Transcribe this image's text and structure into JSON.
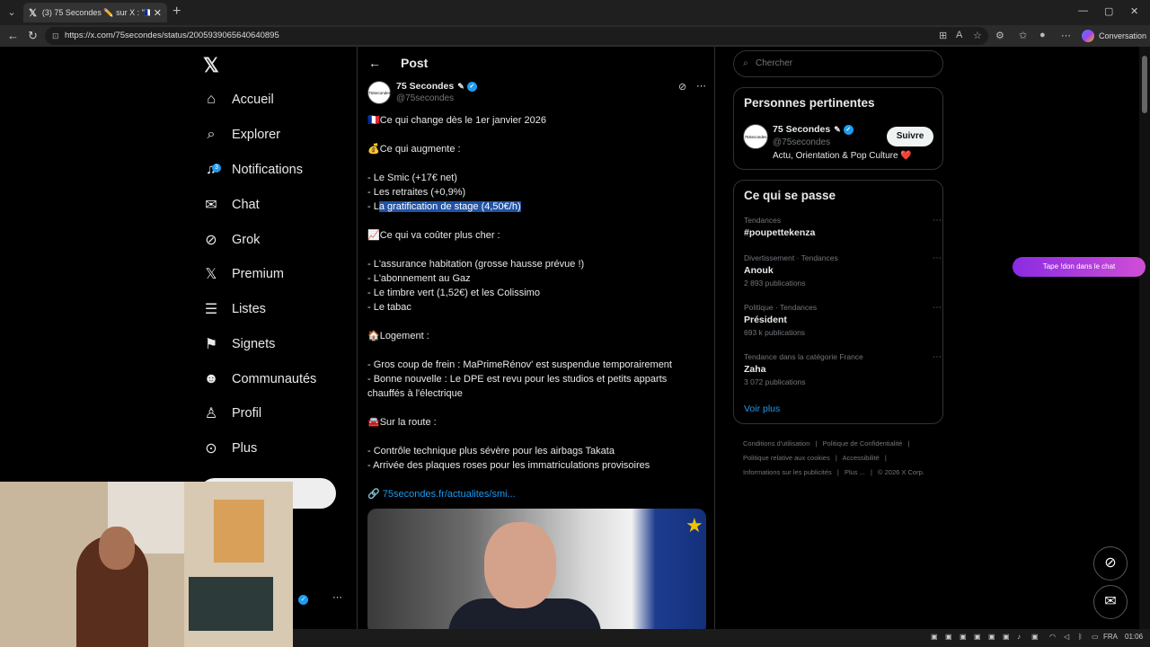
{
  "browser": {
    "tab_title": "(3) 75 Secondes ✏️ sur X : \"🇫🇷Ce c",
    "url": "https://x.com/75secondes/status/2005939065640640895",
    "conversation_label": "Conversation"
  },
  "nav": {
    "items": [
      {
        "label": "Accueil",
        "icon": "home-icon"
      },
      {
        "label": "Explorer",
        "icon": "search-icon"
      },
      {
        "label": "Notifications",
        "icon": "bell-icon",
        "badge": "3"
      },
      {
        "label": "Chat",
        "icon": "mail-icon"
      },
      {
        "label": "Grok",
        "icon": "grok-icon"
      },
      {
        "label": "Premium",
        "icon": "x-icon"
      },
      {
        "label": "Listes",
        "icon": "list-icon"
      },
      {
        "label": "Signets",
        "icon": "bookmark-icon"
      },
      {
        "label": "Communautés",
        "icon": "people-icon"
      },
      {
        "label": "Profil",
        "icon": "user-icon"
      },
      {
        "label": "Plus",
        "icon": "more-circle-icon"
      }
    ]
  },
  "post": {
    "header": "Post",
    "author_name": "75 Secondes",
    "author_handle": "@75secondes",
    "avatar_text": "75Secondes",
    "lines": [
      "🇫🇷Ce qui change dès le 1er janvier 2026",
      "",
      "💰Ce qui augmente :",
      "",
      "- Le Smic (+17€ net)",
      "- Les retraites (+0,9%)",
      "__HL__",
      "",
      "📈Ce qui va coûter plus cher :",
      "",
      "- L'assurance habitation (grosse hausse prévue !)",
      "- L'abonnement au Gaz",
      "- Le timbre vert (1,52€) et les Colissimo",
      "- Le tabac",
      "",
      "🏠Logement :",
      "",
      "- Gros coup de frein : MaPrimeRénov' est suspendue temporairement",
      "- Bonne nouvelle : Le DPE est revu pour les studios et petits apparts",
      "chauffés à l'électrique",
      "",
      "🚘Sur la route :",
      "",
      "- Contrôle technique plus sévère pour les airbags Takata",
      "- Arrivée des plaques roses pour les immatriculations provisoires",
      "",
      "__LINK__"
    ],
    "highlight_prefix": "- L",
    "highlight_text": "a gratification de stage (4,50€/h)",
    "link_prefix": "🔗 ",
    "link_text": "75secondes.fr/actualites/smi..."
  },
  "right": {
    "search_placeholder": "Chercher",
    "relevant": {
      "title": "Personnes pertinentes",
      "name": "75 Secondes",
      "handle": "@75secondes",
      "bio": "Actu, Orientation & Pop Culture ❤️",
      "follow_label": "Suivre",
      "avatar_text": "75Secondes"
    },
    "trends": {
      "title": "Ce qui se passe",
      "items": [
        {
          "meta": "Tendances",
          "name": "#poupettekenza",
          "count": ""
        },
        {
          "meta": "Divertissement · Tendances",
          "name": "Anouk",
          "count": "2 893 publications"
        },
        {
          "meta": "Politique · Tendances",
          "name": "Président",
          "count": "693 k publications"
        },
        {
          "meta": "Tendance dans la catégorie France",
          "name": "Zaha",
          "count": "3 072 publications"
        }
      ],
      "more_label": "Voir plus"
    },
    "footer": {
      "line1": [
        "Conditions d'utilisation",
        "|",
        "Politique de Confidentialité",
        "|"
      ],
      "line2": [
        "Politique relative aux cookies",
        "|",
        "Accessibilité",
        "|"
      ],
      "line3": [
        "Informations sur les publicités",
        "|",
        "Plus ...",
        "|",
        "© 2026 X Corp."
      ]
    }
  },
  "overlay": {
    "chat_pill": "Tape !don dans le chat"
  },
  "taskbar": {
    "lang": "FRA",
    "time": "01:06"
  },
  "colors": {
    "accent": "#1d9bf0",
    "highlight": "#2152a4",
    "background": "#000000"
  }
}
